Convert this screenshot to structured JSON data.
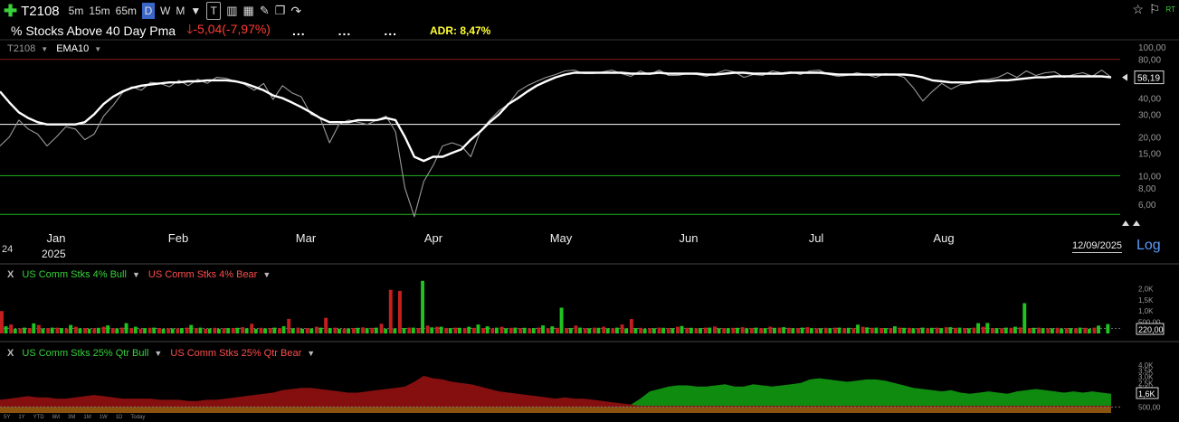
{
  "toolbar": {
    "symbol": "T2108",
    "timeframes": [
      "5m",
      "15m",
      "65m",
      "D",
      "W",
      "M"
    ],
    "active_timeframe": "D"
  },
  "header": {
    "title": "% Stocks Above 40 Day Pma",
    "change": "-5,04(-7,97%)",
    "dots": [
      "...",
      "...",
      "..."
    ],
    "adr": "ADR: 8,47%",
    "rt": "RT"
  },
  "main_panel": {
    "symbol_label": "T2108",
    "indicator_label": "EMA10",
    "year_label": "2025",
    "date_box": "12/09/2025",
    "log_label": "Log",
    "alt_label": "24"
  },
  "volume_panel": {
    "close": "X",
    "bull_label": "US Comm Stks 4% Bull",
    "bear_label": "US Comm Stks 4% Bear"
  },
  "qtr_panel": {
    "close": "X",
    "bull_label": "US Comm Stks 25% Qtr Bull",
    "bear_label": "US Comm Stks 25% Qtr Bear"
  },
  "range_buttons": [
    "5Y",
    "1Y",
    "YTD",
    "6M",
    "3M",
    "1M",
    "1W",
    "1D",
    "Today"
  ],
  "colors": {
    "price": "#9a9a9a",
    "ema": "#ffffff",
    "bull": "#1fc41f",
    "bear": "#c41f1f",
    "level_white": "#ffffff",
    "level_green": "#1fb51f",
    "level_red": "#8b1a1a",
    "qtr_bull_fill": "#0f8c0f",
    "qtr_bear_fill": "#8c1010",
    "qtr_base_fill": "#8a5a10"
  },
  "chart_data": [
    {
      "type": "line",
      "scale": "log",
      "x_ticks": [
        "Jan",
        "Feb",
        "Mar",
        "Apr",
        "May",
        "Jun",
        "Jul",
        "Aug"
      ],
      "y_ticks": [
        100,
        80,
        60,
        40,
        30,
        20,
        15,
        10,
        8,
        6
      ],
      "y_tick_labels": [
        "100,00",
        "80,00",
        "60,00",
        "40,00",
        "30,00",
        "20,00",
        "15,00",
        "10,00",
        "8,00",
        "6,00"
      ],
      "ylim": [
        4.2,
        110
      ],
      "last_value": "58,19",
      "horizontal_levels": [
        {
          "value": 80,
          "color": "red"
        },
        {
          "value": 25,
          "color": "white"
        },
        {
          "value": 10,
          "color": "green"
        },
        {
          "value": 5,
          "color": "green"
        }
      ],
      "series": [
        {
          "key": "price",
          "values": [
            17,
            20,
            27,
            23,
            21,
            17,
            20,
            24,
            23,
            19,
            21,
            29,
            35,
            44,
            49,
            46,
            53,
            52,
            49,
            55,
            50,
            56,
            52,
            58,
            57,
            54,
            51,
            46,
            52,
            39,
            50,
            44,
            41,
            30,
            28,
            18,
            25,
            27,
            26,
            25,
            27,
            29,
            22,
            8,
            4.8,
            9,
            12,
            17,
            18,
            17,
            14,
            22,
            27,
            32,
            36,
            45,
            50,
            54,
            58,
            61,
            65,
            66,
            62,
            62,
            64,
            66,
            62,
            59,
            65,
            61,
            66,
            60,
            60,
            62,
            61,
            59,
            62,
            66,
            64,
            58,
            61,
            60,
            65,
            63,
            64,
            61,
            65,
            66,
            61,
            59,
            60,
            63,
            61,
            58,
            62,
            61,
            58,
            48,
            38,
            45,
            52,
            47,
            51,
            52,
            55,
            56,
            58,
            63,
            58,
            65,
            60,
            63,
            64,
            58,
            61,
            63,
            59,
            66,
            58
          ]
        },
        {
          "key": "ema",
          "values": [
            45,
            37,
            31,
            28,
            26,
            25,
            25,
            25,
            25,
            26,
            30,
            36,
            41,
            45,
            48,
            50,
            51,
            52,
            53,
            53,
            54,
            54,
            55,
            55,
            55,
            54,
            52,
            49,
            46,
            42,
            40,
            37,
            34,
            31,
            28,
            26,
            26,
            26,
            27,
            27,
            27,
            28,
            27,
            20,
            14,
            13,
            14,
            14,
            15,
            16,
            19,
            22,
            26,
            30,
            36,
            40,
            45,
            50,
            54,
            58,
            61,
            63,
            63,
            63,
            63,
            63,
            63,
            62,
            62,
            62,
            63,
            62,
            62,
            62,
            62,
            61,
            61,
            62,
            63,
            63,
            62,
            62,
            62,
            62,
            63,
            63,
            63,
            63,
            62,
            61,
            61,
            61,
            61,
            61,
            61,
            61,
            61,
            60,
            58,
            55,
            54,
            53,
            53,
            53,
            54,
            54,
            55,
            55,
            56,
            57,
            58,
            58,
            59,
            59,
            59,
            59,
            59,
            59,
            58
          ]
        }
      ]
    },
    {
      "type": "bar",
      "y_ticks": [
        2000,
        1500,
        1000,
        500,
        220
      ],
      "y_tick_labels": [
        "2,0K",
        "1,5K",
        "1,0K",
        "500,00",
        "220,00"
      ],
      "ylim": [
        0,
        2300
      ],
      "last_value": "220,00",
      "series": [
        {
          "key": "bull",
          "values": [
            320,
            210,
            260,
            450,
            220,
            260,
            240,
            380,
            230,
            210,
            250,
            360,
            220,
            460,
            300,
            240,
            260,
            210,
            220,
            240,
            380,
            260,
            220,
            210,
            240,
            250,
            230,
            210,
            220,
            260,
            320,
            230,
            210,
            220,
            260,
            240,
            210,
            220,
            250,
            230,
            260,
            210,
            220,
            240,
            260,
            2350,
            270,
            300,
            240,
            250,
            300,
            400,
            320,
            260,
            230,
            260,
            250,
            240,
            360,
            320,
            1150,
            240,
            260,
            230,
            250,
            230,
            260,
            220,
            240,
            210,
            230,
            250,
            240,
            330,
            250,
            240,
            260,
            230,
            240,
            250,
            230,
            260,
            240,
            250,
            280,
            240,
            260,
            240,
            230,
            240,
            260,
            250,
            390,
            270,
            260,
            240,
            320,
            250,
            230,
            260,
            250,
            240,
            280,
            260,
            230,
            460,
            470,
            240,
            260,
            300,
            1350,
            250,
            240,
            230,
            220,
            240,
            260,
            210,
            350,
            420
          ]
        },
        {
          "key": "bear",
          "values": [
            1000,
            400,
            220,
            240,
            380,
            240,
            260,
            220,
            300,
            240,
            230,
            300,
            240,
            260,
            240,
            210,
            250,
            240,
            230,
            220,
            260,
            240,
            210,
            250,
            230,
            240,
            280,
            430,
            250,
            240,
            230,
            650,
            260,
            240,
            300,
            700,
            260,
            220,
            240,
            270,
            250,
            430,
            1950,
            1900,
            260,
            240,
            350,
            300,
            240,
            260,
            230,
            250,
            240,
            220,
            300,
            250,
            240,
            220,
            260,
            230,
            250,
            240,
            350,
            230,
            260,
            300,
            230,
            400,
            640,
            250,
            230,
            260,
            240,
            300,
            250,
            230,
            260,
            310,
            240,
            250,
            280,
            240,
            230,
            300,
            260,
            250,
            240,
            280,
            230,
            250,
            260,
            240,
            230,
            300,
            250,
            240,
            230,
            260,
            250,
            240,
            230,
            260,
            280,
            250,
            240,
            260,
            300,
            240,
            230,
            250,
            270,
            240,
            260,
            230,
            250,
            240,
            230,
            250,
            260
          ]
        }
      ]
    },
    {
      "type": "area",
      "y_ticks": [
        4000,
        3500,
        3000,
        2500,
        2000,
        1600,
        500
      ],
      "y_tick_labels": [
        "4,0K",
        "3,5K",
        "3,0K",
        "2,5K",
        "2,0K",
        "1,6K",
        "500,00"
      ],
      "ylim": [
        0,
        4300
      ],
      "last_value": "1,6K",
      "series": [
        {
          "key": "qtr_bull",
          "values": [
            500,
            500,
            500,
            500,
            500,
            500,
            500,
            500,
            500,
            500,
            500,
            500,
            500,
            500,
            500,
            500,
            500,
            500,
            500,
            500,
            500,
            500,
            500,
            500,
            500,
            500,
            500,
            500,
            500,
            500,
            500,
            500,
            500,
            500,
            500,
            500,
            500,
            500,
            500,
            500,
            500,
            500,
            500,
            500,
            500,
            500,
            500,
            500,
            500,
            500,
            500,
            500,
            500,
            500,
            500,
            500,
            500,
            500,
            500,
            500,
            500,
            500,
            500,
            500,
            500,
            500,
            600,
            700,
            1200,
            1800,
            2000,
            2200,
            2300,
            2300,
            2200,
            2200,
            2300,
            2400,
            2200,
            2200,
            2400,
            2300,
            2200,
            2300,
            2400,
            2500,
            2800,
            2900,
            2800,
            2700,
            2600,
            2700,
            2800,
            2800,
            2700,
            2500,
            2300,
            2100,
            2000,
            1900,
            1800,
            1900,
            1700,
            1600,
            1700,
            1800,
            1700,
            1600,
            1800,
            1900,
            2000,
            1900,
            1800,
            1700,
            1800,
            1700,
            1800,
            1700,
            1600
          ]
        },
        {
          "key": "qtr_bear",
          "values": [
            1100,
            1200,
            1300,
            1400,
            1300,
            1300,
            1200,
            1200,
            1300,
            1400,
            1500,
            1400,
            1300,
            1200,
            1200,
            1200,
            1200,
            1100,
            1100,
            1100,
            1000,
            1000,
            1100,
            1100,
            1200,
            1300,
            1400,
            1500,
            1600,
            1700,
            1900,
            2000,
            2100,
            2100,
            2000,
            1900,
            1800,
            1700,
            1700,
            1800,
            1900,
            2000,
            2100,
            2200,
            2600,
            3100,
            2900,
            2800,
            2600,
            2500,
            2400,
            2200,
            2000,
            1800,
            1700,
            1600,
            1500,
            1400,
            1300,
            1200,
            1300,
            1200,
            1200,
            1100,
            1000,
            900,
            800,
            700,
            600,
            600,
            600,
            600,
            600,
            600,
            600,
            600,
            600,
            600,
            600,
            600,
            600,
            600,
            600,
            600,
            600,
            600,
            600,
            600,
            600,
            600,
            600,
            600,
            600,
            600,
            600,
            600,
            600,
            600,
            600,
            600,
            600,
            600,
            600,
            600,
            600,
            600,
            600,
            600,
            600,
            600,
            600,
            600,
            600,
            600,
            600,
            600,
            600,
            600,
            600
          ]
        }
      ]
    }
  ]
}
